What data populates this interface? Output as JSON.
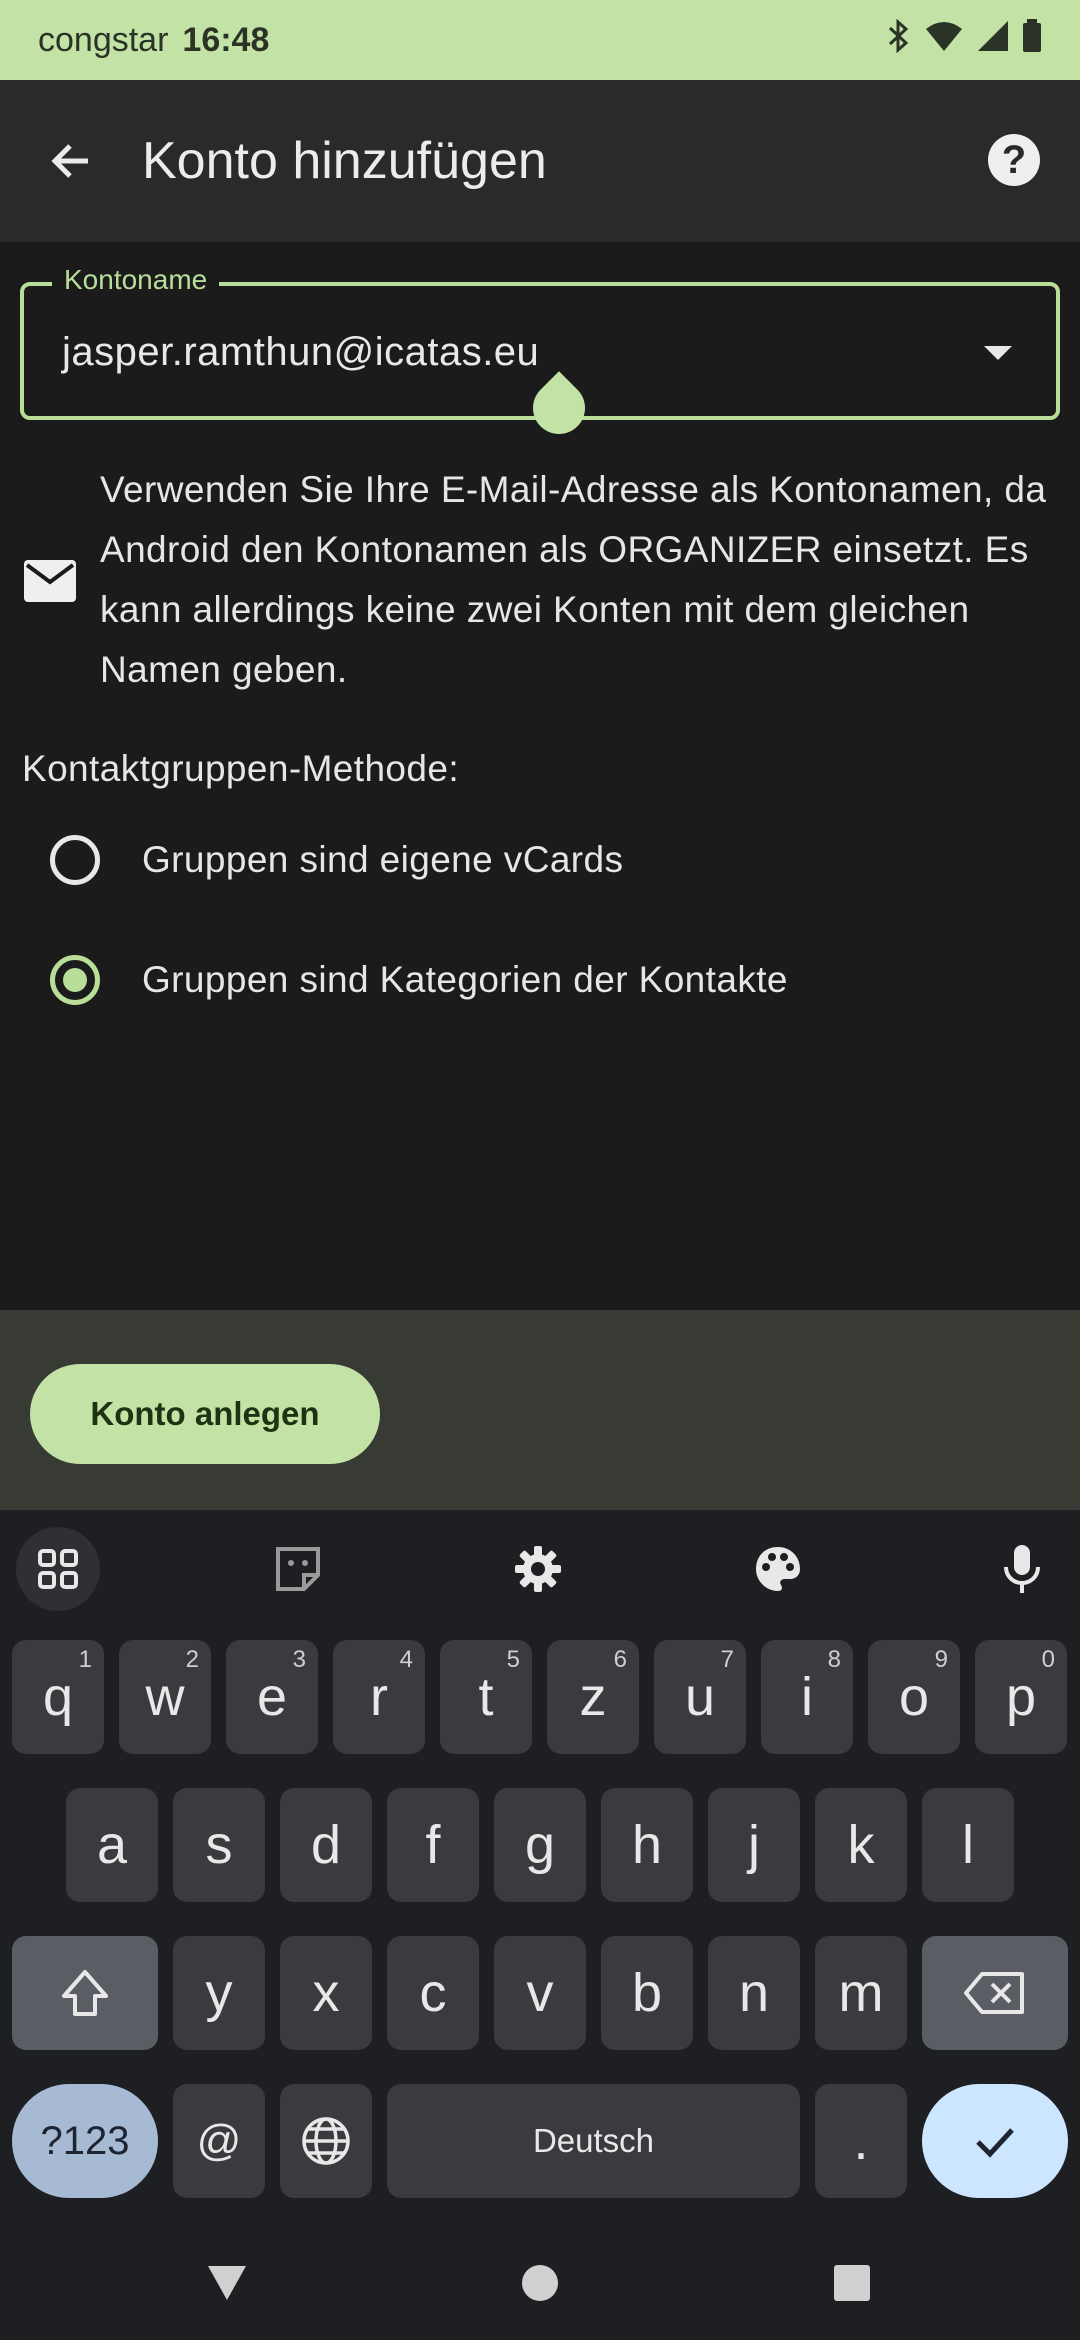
{
  "status_bar": {
    "carrier": "congstar",
    "time": "16:48",
    "icons": [
      "bluetooth-icon",
      "wifi-icon",
      "signal-icon",
      "battery-icon"
    ]
  },
  "app_bar": {
    "title": "Konto hinzufügen",
    "back_icon": "arrow-back-icon",
    "help_icon": "help-icon",
    "help_glyph": "?"
  },
  "account_field": {
    "label": "Kontoname",
    "value": "jasper.ramthun@icatas.eu"
  },
  "info": {
    "icon": "mail-icon",
    "text": "Verwenden Sie Ihre E-Mail-Adresse als Kontonamen, da Android den Kontonamen als ORGANIZER einsetzt. Es kann allerdings keine zwei Konten mit dem gleichen Namen geben."
  },
  "contact_group": {
    "label": "Kontaktgruppen-Methode:",
    "options": [
      {
        "label": "Gruppen sind eigene vCards",
        "checked": false
      },
      {
        "label": "Gruppen sind Kategorien der Kontakte",
        "checked": true
      }
    ]
  },
  "primary_button": {
    "label": "Konto anlegen"
  },
  "keyboard": {
    "row1": [
      {
        "k": "q",
        "h": "1"
      },
      {
        "k": "w",
        "h": "2"
      },
      {
        "k": "e",
        "h": "3"
      },
      {
        "k": "r",
        "h": "4"
      },
      {
        "k": "t",
        "h": "5"
      },
      {
        "k": "z",
        "h": "6"
      },
      {
        "k": "u",
        "h": "7"
      },
      {
        "k": "i",
        "h": "8"
      },
      {
        "k": "o",
        "h": "9"
      },
      {
        "k": "p",
        "h": "0"
      }
    ],
    "row2": [
      "a",
      "s",
      "d",
      "f",
      "g",
      "h",
      "j",
      "k",
      "l"
    ],
    "row3": [
      "y",
      "x",
      "c",
      "v",
      "b",
      "n",
      "m"
    ],
    "symbols_label": "?123",
    "at_label": "@",
    "space_label": "Deutsch",
    "period_label": "."
  },
  "colors": {
    "accent": "#b9de98",
    "status_bar": "#c3e3a6",
    "background": "#1b1b1b"
  }
}
